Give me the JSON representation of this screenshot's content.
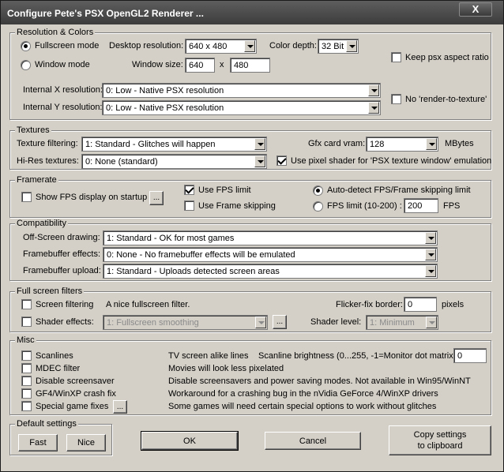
{
  "window": {
    "title": "Configure Pete's PSX OpenGL2 Renderer ...",
    "close_label": "X"
  },
  "resolution": {
    "group_title": "Resolution & Colors",
    "fullscreen_mode": "Fullscreen mode",
    "window_mode": "Window mode",
    "desktop_resolution_label": "Desktop resolution:",
    "desktop_resolution_value": "640 x  480",
    "color_depth_label": "Color depth:",
    "color_depth_value": "32 Bit",
    "keep_aspect": "Keep psx aspect ratio",
    "window_size_label": "Window size:",
    "window_width": "640",
    "window_x": "x",
    "window_height": "480",
    "internal_x_label": "Internal X resolution:",
    "internal_x_value": "0: Low  - Native PSX resolution",
    "internal_y_label": "Internal Y resolution:",
    "internal_y_value": "0: Low  - Native PSX resolution",
    "no_rtt": "No 'render-to-texture'"
  },
  "textures": {
    "group_title": "Textures",
    "filtering_label": "Texture filtering:",
    "filtering_value": "1: Standard - Glitches will happen",
    "gfx_vram_label": "Gfx card vram:",
    "gfx_vram_value": "128",
    "mbytes": "MBytes",
    "hires_label": "Hi-Res textures:",
    "hires_value": "0: None (standard)",
    "pixel_shader": "Use pixel shader for 'PSX texture window' emulation"
  },
  "framerate": {
    "group_title": "Framerate",
    "show_fps": "Show FPS display on startup",
    "dots": "...",
    "use_fps_limit": "Use FPS limit",
    "use_frame_skipping": "Use Frame skipping",
    "auto_detect": "Auto-detect FPS/Frame skipping limit",
    "fps_limit_label": "FPS limit (10-200) :",
    "fps_limit_value": "200",
    "fps_unit": "FPS"
  },
  "compat": {
    "group_title": "Compatibility",
    "offscreen_label": "Off-Screen drawing:",
    "offscreen_value": "1: Standard - OK for most games",
    "fb_effects_label": "Framebuffer effects:",
    "fb_effects_value": "0: None - No framebuffer effects will be emulated",
    "fb_upload_label": "Framebuffer upload:",
    "fb_upload_value": "1: Standard - Uploads detected screen areas"
  },
  "fsfilters": {
    "group_title": "Full screen filters",
    "screen_filtering": "Screen filtering",
    "screen_filtering_desc": "A nice fullscreen filter.",
    "flicker_label": "Flicker-fix border:",
    "flicker_value": "0",
    "pixels": "pixels",
    "shader_effects": "Shader effects:",
    "shader_effects_value": "1: Fullscreen smoothing",
    "dots": "...",
    "shader_level_label": "Shader level:",
    "shader_level_value": "1: Minimum"
  },
  "misc": {
    "group_title": "Misc",
    "items": [
      {
        "label": "Scanlines",
        "desc": "TV screen alike lines"
      },
      {
        "label": "MDEC filter",
        "desc": "Movies will look less pixelated"
      },
      {
        "label": "Disable screensaver",
        "desc": "Disable screensavers and power saving modes. Not available in Win95/WinNT"
      },
      {
        "label": "GF4/WinXP crash fix",
        "desc": "Workaround for a crashing bug in the nVidia GeForce 4/WinXP drivers"
      },
      {
        "label": "Special game fixes",
        "desc": "Some games will need certain special options to work without glitches"
      }
    ],
    "scanline_brightness_label": "Scanline brightness (0...255, -1=Monitor dot matrix):",
    "scanline_brightness_value": "0",
    "dots": "..."
  },
  "defaults": {
    "group_title": "Default settings",
    "fast": "Fast",
    "nice": "Nice"
  },
  "buttons": {
    "ok": "OK",
    "cancel": "Cancel",
    "copy_line1": "Copy settings",
    "copy_line2": "to clipboard"
  }
}
